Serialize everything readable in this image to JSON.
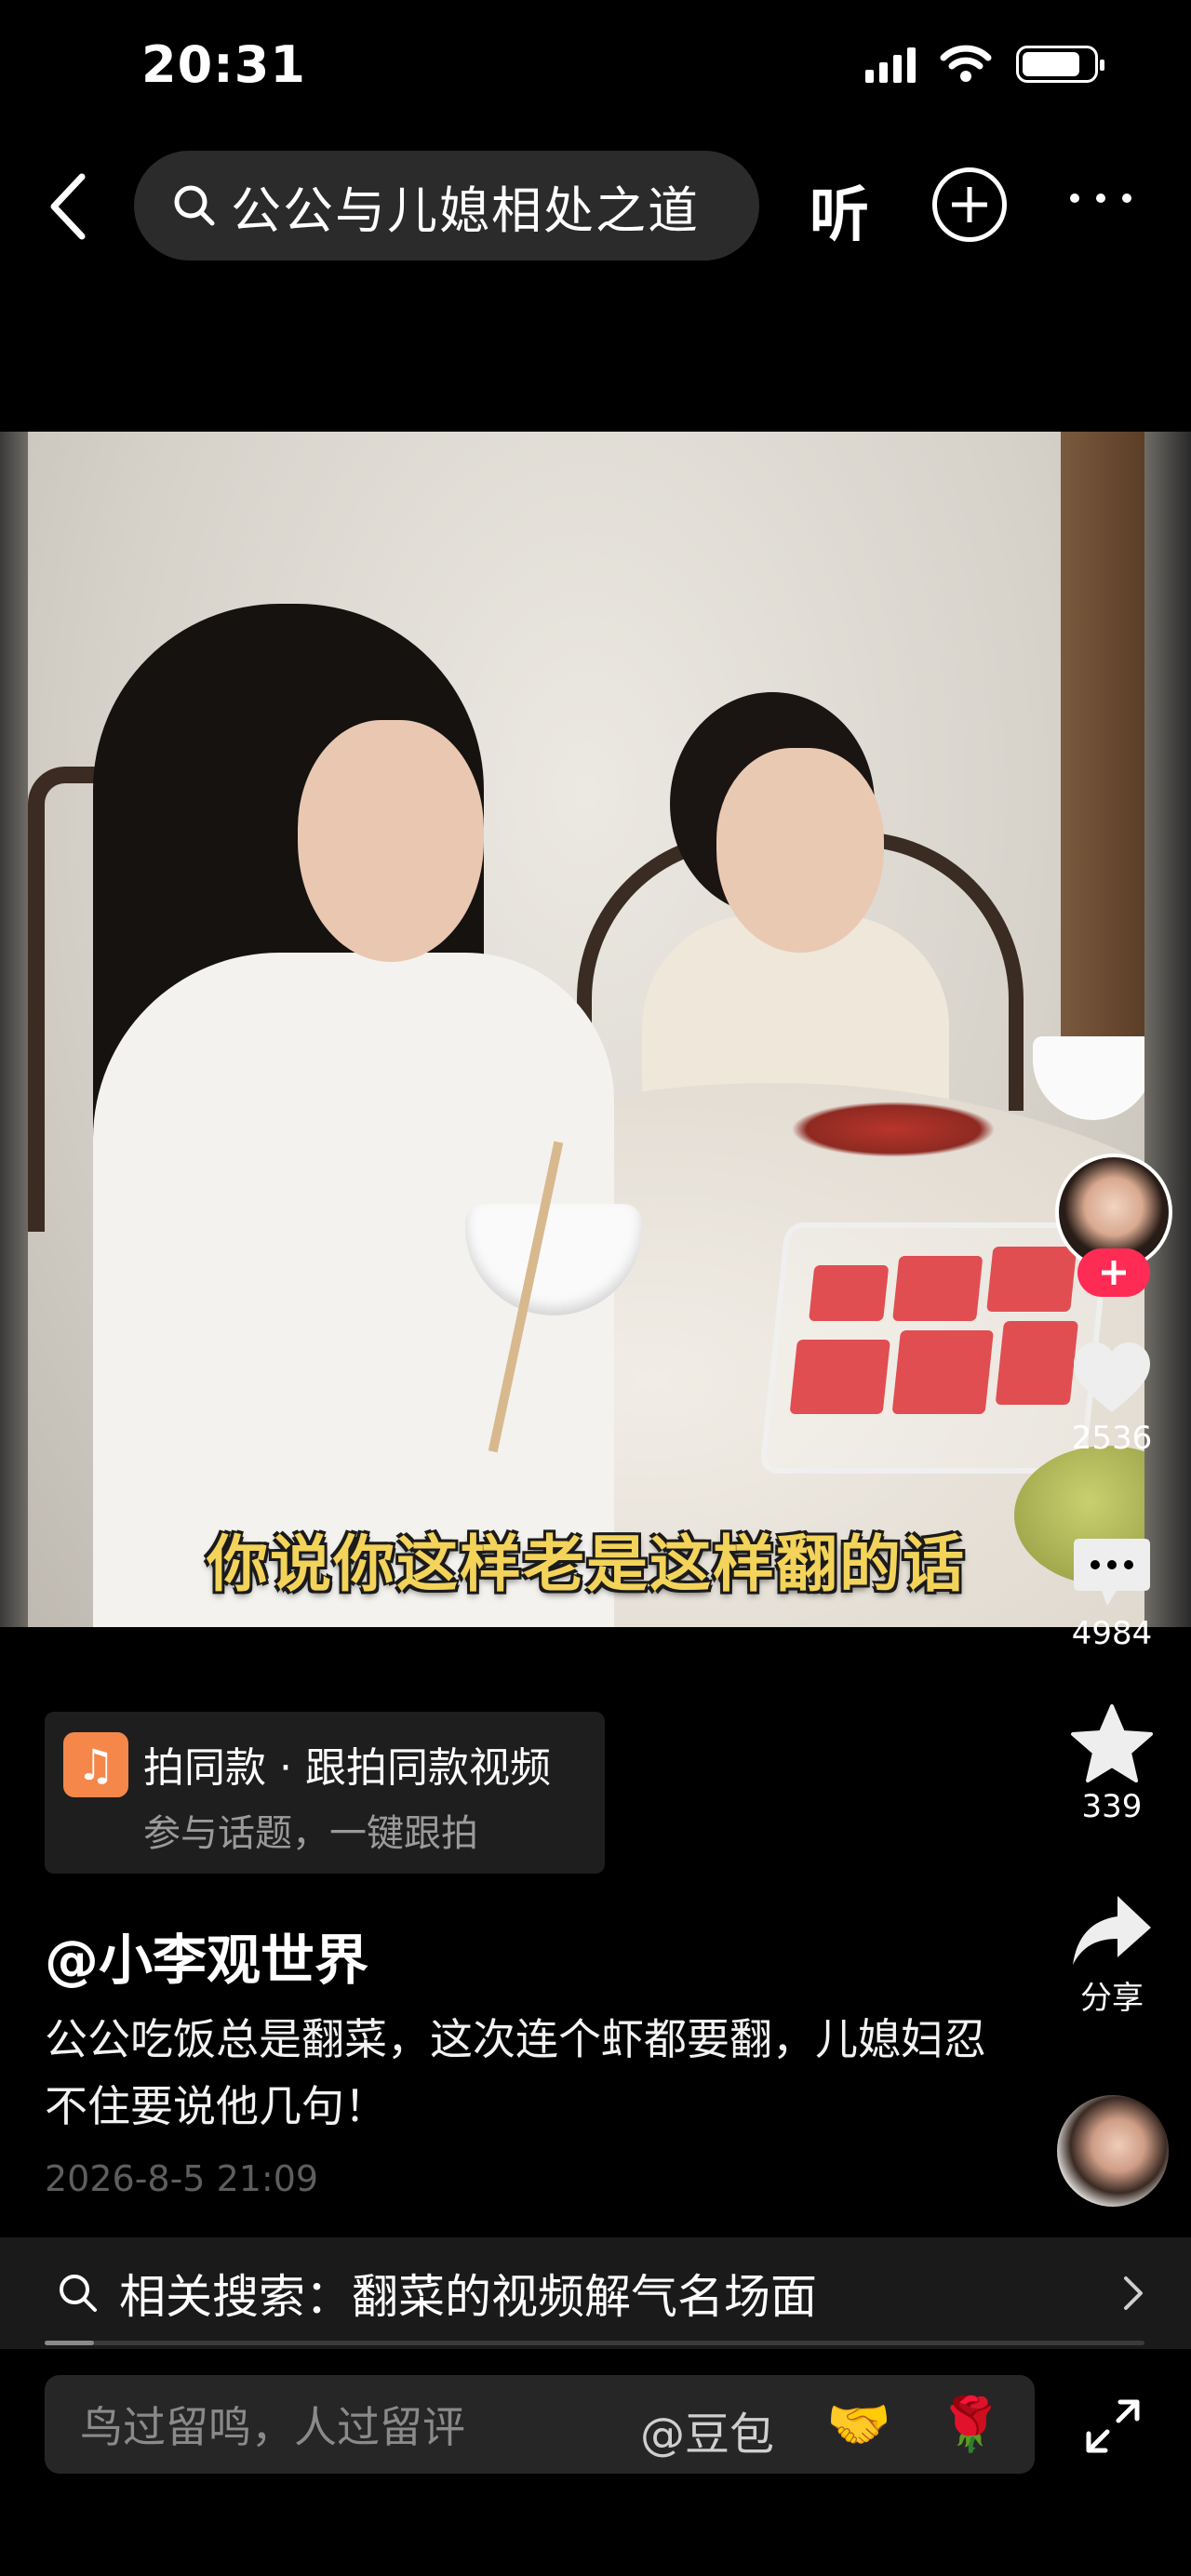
{
  "status_bar": {
    "time": "20:31"
  },
  "top_bar": {
    "search_query": "公公与儿媳相处之道",
    "listen_label": "听"
  },
  "video": {
    "subtitle": "你说你这样老是这样翻的话"
  },
  "actions": {
    "like_count": "2536",
    "comment_count": "4984",
    "favorite_count": "339",
    "share_label": "分享"
  },
  "capcut_card": {
    "title": "拍同款 · 跟拍同款视频",
    "subtitle": "参与话题，一键跟拍"
  },
  "post": {
    "author": "@小李观世界",
    "description": "公公吃饭总是翻菜，这次连个虾都要翻，儿媳妇忍不住要说他几句！",
    "time": "2026-8-5 21:09"
  },
  "related_search": {
    "text": "相关搜索：翻菜的视频解气名场面"
  },
  "playback": {
    "progress": 0.045
  },
  "comment_bar": {
    "placeholder": "鸟过留鸣，人过留评",
    "mention": "@豆包",
    "emoji_1": "🤝",
    "emoji_2": "🌹"
  },
  "colors": {
    "accent": "#fe2c55",
    "subtitle_yellow": "#f3d35a",
    "capcut_orange": "#f5874a"
  }
}
